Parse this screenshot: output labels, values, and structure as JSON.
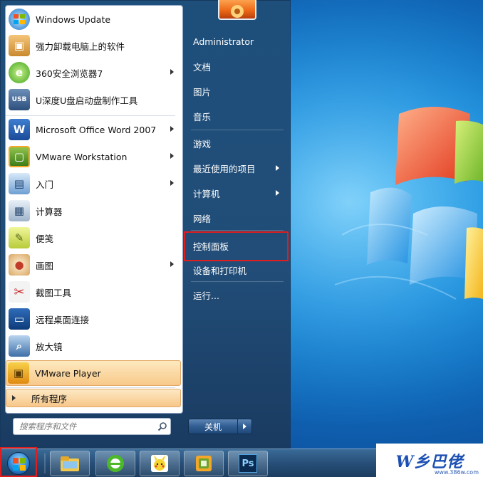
{
  "start_menu": {
    "programs": [
      {
        "label": "Windows Update",
        "icon": "windows-update-icon",
        "has_submenu": false
      },
      {
        "label": "强力卸载电脑上的软件",
        "icon": "uninstall-box-icon",
        "has_submenu": false
      },
      {
        "label": "360安全浏览器7",
        "icon": "360-browser-icon",
        "has_submenu": true
      },
      {
        "label": "U深度U盘启动盘制作工具",
        "icon": "usb-drive-icon",
        "has_submenu": false
      },
      {
        "label": "Microsoft Office Word 2007",
        "icon": "word-icon",
        "has_submenu": true
      },
      {
        "label": "VMware Workstation",
        "icon": "vmware-workstation-icon",
        "has_submenu": true
      },
      {
        "label": "入门",
        "icon": "getting-started-icon",
        "has_submenu": true
      },
      {
        "label": "计算器",
        "icon": "calculator-icon",
        "has_submenu": false
      },
      {
        "label": "便笺",
        "icon": "sticky-notes-icon",
        "has_submenu": false
      },
      {
        "label": "画图",
        "icon": "paint-icon",
        "has_submenu": true
      },
      {
        "label": "截图工具",
        "icon": "snipping-tool-icon",
        "has_submenu": false
      },
      {
        "label": "远程桌面连接",
        "icon": "remote-desktop-icon",
        "has_submenu": false
      },
      {
        "label": "放大镜",
        "icon": "magnifier-icon",
        "has_submenu": false
      },
      {
        "label": "VMware Player",
        "icon": "vmware-player-icon",
        "has_submenu": false
      }
    ],
    "all_programs_label": "所有程序",
    "search_placeholder": "搜索程序和文件",
    "right_items": [
      {
        "label": "Administrator",
        "has_submenu": false
      },
      {
        "label": "文档",
        "has_submenu": false
      },
      {
        "label": "图片",
        "has_submenu": false
      },
      {
        "label": "音乐",
        "has_submenu": false
      },
      {
        "label": "游戏",
        "has_submenu": false
      },
      {
        "label": "最近使用的项目",
        "has_submenu": true
      },
      {
        "label": "计算机",
        "has_submenu": true
      },
      {
        "label": "网络",
        "has_submenu": false
      },
      {
        "label": "控制面板",
        "has_submenu": false
      },
      {
        "label": "设备和打印机",
        "has_submenu": false
      },
      {
        "label": "运行...",
        "has_submenu": false
      }
    ],
    "shutdown_label": "关机",
    "highlighted_item": "控制面板"
  },
  "taskbar": {
    "pinned": [
      "explorer-icon",
      "360-browser-icon",
      "pikachu-app-icon",
      "vmware-workstation-icon",
      "photoshop-icon"
    ],
    "photoshop_label": "Ps"
  },
  "watermark": {
    "text": "W乡巴佬",
    "url": "www.386w.com"
  },
  "colors": {
    "highlight_frame": "#e01e1e",
    "menu_right_bg": "#214d78",
    "menu_left_bg": "#ffffff",
    "accent_orange": "#f8c98a"
  }
}
